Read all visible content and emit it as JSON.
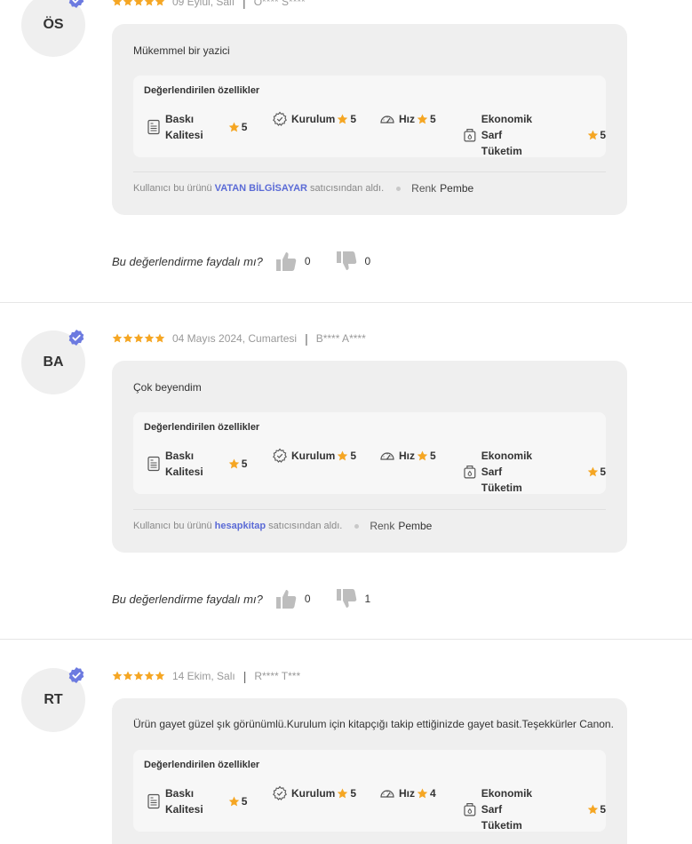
{
  "labels": {
    "features_title": "Değerlendirilen özellikler",
    "helpful_question": "Bu değerlendirme faydalı mı?",
    "seller_prefix": "Kullanıcı bu ürünü",
    "seller_suffix": "satıcısından aldı.",
    "color_label": "Renk",
    "feature_names": {
      "print_quality_line1": "Baskı",
      "print_quality_line2": "Kalitesi",
      "setup": "Kurulum",
      "speed": "Hız",
      "economy_line1": "Ekonomik Sarf",
      "economy_line2": "Tüketim"
    }
  },
  "icons": {
    "star": "star-icon",
    "verified": "verified-badge-icon",
    "print_quality": "document-icon",
    "setup": "gear-check-icon",
    "speed": "speedometer-icon",
    "economy": "ink-cartridge-icon",
    "like": "thumbs-up-icon",
    "dislike": "thumbs-down-icon"
  },
  "colors": {
    "star": "#f5a623",
    "verified": "#6c7ae0",
    "seller_link": "#5b6bd6",
    "thumb": "#bdbdbd"
  },
  "reviews": [
    {
      "initials": "ÖS",
      "rating": 5,
      "date": "09 Eylül, Salı",
      "user": "Ö****  S****",
      "comment": "Mükemmel bir yazici",
      "scores": {
        "print_quality": "5",
        "setup": "5",
        "speed": "5",
        "economy": "5"
      },
      "seller": "VATAN BİLGİSAYAR",
      "color": "Pembe",
      "likes": "0",
      "dislikes": "0"
    },
    {
      "initials": "BA",
      "rating": 5,
      "date": "04 Mayıs 2024, Cumartesi",
      "user": "B**** A****",
      "comment": "Çok  beyendim",
      "scores": {
        "print_quality": "5",
        "setup": "5",
        "speed": "5",
        "economy": "5"
      },
      "seller": "hesapkitap",
      "color": "Pembe",
      "likes": "0",
      "dislikes": "1"
    },
    {
      "initials": "RT",
      "rating": 5,
      "date": "14 Ekim, Salı",
      "user": "R**** T***",
      "comment": "Ürün gayet güzel şık görünümlü.Kurulum için kitapçığı takip ettiğinizde gayet basit.Teşekkürler Canon.",
      "scores": {
        "print_quality": "5",
        "setup": "5",
        "speed": "4",
        "economy": "5"
      },
      "seller": "",
      "color": "",
      "likes": "",
      "dislikes": ""
    }
  ]
}
